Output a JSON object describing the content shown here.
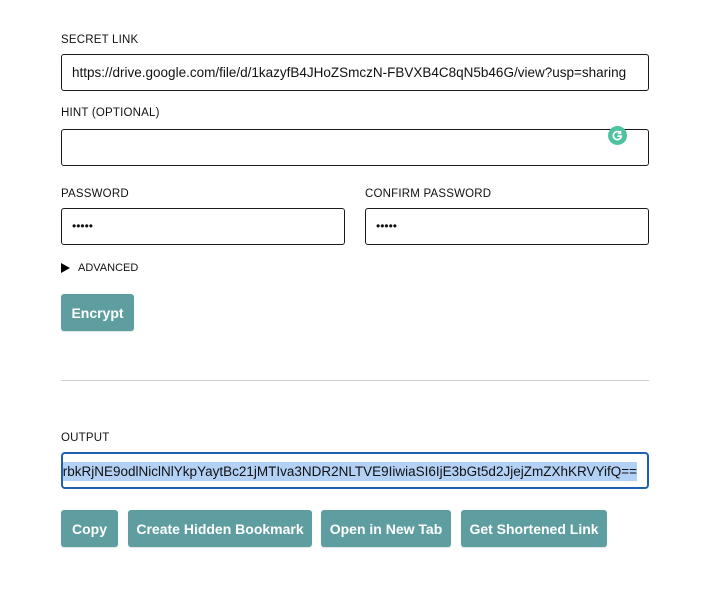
{
  "secret_link": {
    "label": "SECRET LINK",
    "value": "https://drive.google.com/file/d/1kazyfB4JHoZSmczN-FBVXB4C8qN5b46G/view?usp=sharing"
  },
  "hint": {
    "label_main": "HINT ",
    "label_optional": "(OPTIONAL)",
    "value": ""
  },
  "password": {
    "label": "PASSWORD",
    "value": "•••••"
  },
  "confirm_password": {
    "label": "CONFIRM PASSWORD",
    "value": "•••••"
  },
  "advanced": {
    "label": "ADVANCED",
    "icon": "disclosure-triangle-right"
  },
  "encrypt_button": {
    "label": "Encrypt"
  },
  "output": {
    "label": "OUTPUT",
    "value": "rbkRjNE9odlNiclNlYkpYaytBc21jMTIva3NDR2NLTVE9IiwiaSI6IjE3bGt5d2JjejZmZXhKRVYifQ=="
  },
  "actions": {
    "copy": "Copy",
    "bookmark": "Create Hidden Bookmark",
    "new_tab": "Open in New Tab",
    "shorten": "Get Shortened Link"
  },
  "colors": {
    "button_bg": "#5f9ea0",
    "button_text": "#ffffff",
    "output_focus_border": "#1f5fb0",
    "selection": "#b3d1f5",
    "grammarly": "#4fc3a1"
  },
  "icons": {
    "grammarly": "grammarly-icon"
  }
}
